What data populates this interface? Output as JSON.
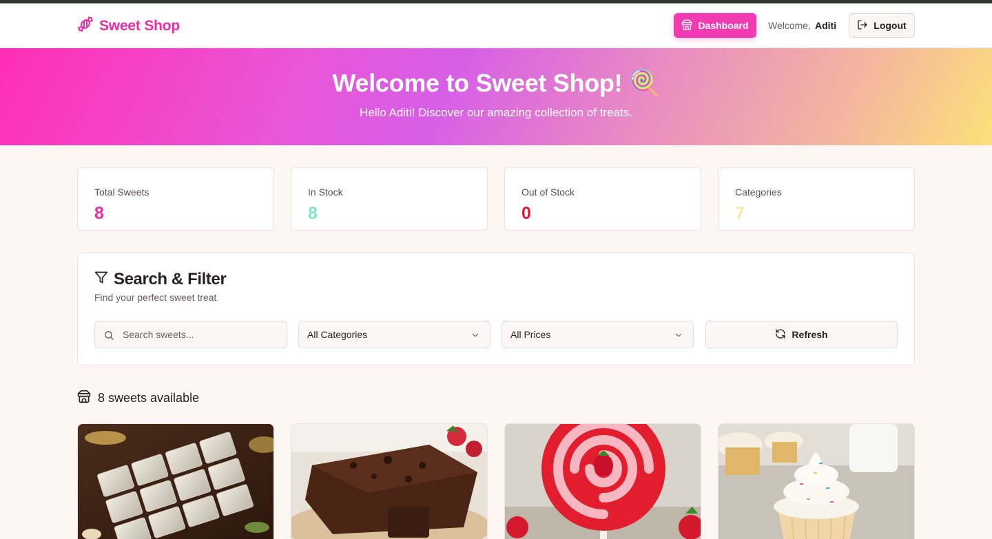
{
  "header": {
    "brand": "Sweet Shop",
    "dashboard_label": "Dashboard",
    "welcome_prefix": "Welcome,",
    "user_name": "Aditi",
    "logout_label": "Logout"
  },
  "hero": {
    "title": "Welcome to Sweet Shop! 🍭",
    "subtitle": "Hello Aditi! Discover our amazing collection of treats."
  },
  "stats": [
    {
      "label": "Total Sweets",
      "value": "8",
      "color": "#f02ba8"
    },
    {
      "label": "In Stock",
      "value": "8",
      "color": "#7fe3c4"
    },
    {
      "label": "Out of Stock",
      "value": "0",
      "color": "#e8133b"
    },
    {
      "label": "Categories",
      "value": "7",
      "color": "#fce7a6"
    }
  ],
  "filter": {
    "title": "Search & Filter",
    "subtitle": "Find your perfect sweet treat",
    "search_placeholder": "Search sweets...",
    "category_selected": "All Categories",
    "price_selected": "All Prices",
    "refresh_label": "Refresh"
  },
  "listing": {
    "count_text": "8 sweets available"
  },
  "products": [
    {
      "image": "kaju-katli-image"
    },
    {
      "image": "chocolate-brownie-image"
    },
    {
      "image": "strawberry-lollipop-image"
    },
    {
      "image": "vanilla-cupcake-image"
    }
  ],
  "colors": {
    "brand": "#f02ba8",
    "dashboard_button": "#f23bb2",
    "background": "#fdf6f3"
  }
}
